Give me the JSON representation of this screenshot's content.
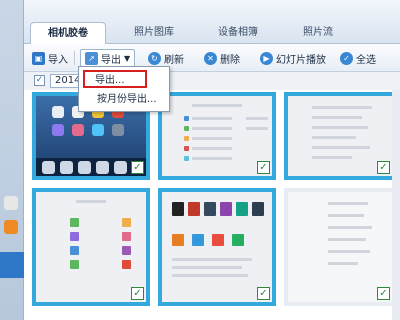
{
  "tabs": [
    {
      "label": "相机胶卷",
      "active": true
    },
    {
      "label": "照片图库",
      "active": false
    },
    {
      "label": "设备相簿",
      "active": false
    },
    {
      "label": "照片流",
      "active": false
    }
  ],
  "toolbar": {
    "import_label": "导入",
    "export_label": "导出",
    "refresh_label": "刷新",
    "delete_label": "删除",
    "slideshow_label": "幻灯片播放",
    "select_all_label": "全选"
  },
  "year_group": {
    "label": "2014",
    "checked": true
  },
  "export_menu": {
    "items": [
      "导出...",
      "按月份导出..."
    ]
  },
  "thumbnails": [
    {
      "kind": "ipad-homescreen",
      "selected": true
    },
    {
      "kind": "settings-screenshot",
      "selected": true
    },
    {
      "kind": "settings-screenshot",
      "selected": true
    },
    {
      "kind": "app-screen",
      "selected": true
    },
    {
      "kind": "app-store-screen",
      "selected": true
    },
    {
      "kind": "settings-screenshot",
      "selected": true
    }
  ],
  "colors": {
    "selection_border": "#34a9dd",
    "accent_blue": "#2f78c8",
    "menu_highlight": "#d62020",
    "check_green": "#2c8a3a"
  }
}
